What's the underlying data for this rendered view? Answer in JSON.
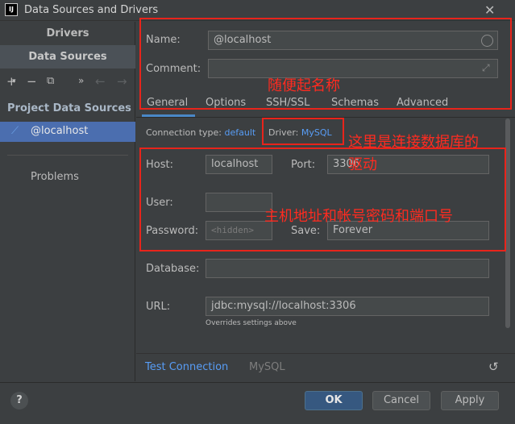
{
  "window": {
    "title": "Data Sources and Drivers",
    "app_icon": "IJ"
  },
  "sidebar": {
    "tabs": [
      {
        "label": "Drivers"
      },
      {
        "label": "Data Sources"
      }
    ],
    "toolbar_icons": [
      "plus-icon",
      "minus-icon",
      "copy-icon",
      "more-icon",
      "back-arrow-icon",
      "forward-arrow-icon"
    ],
    "section_title": "Project Data Sources",
    "items": [
      {
        "label": "@localhost",
        "icon": "mysql-dolphin-icon"
      }
    ],
    "problems_label": "Problems"
  },
  "form": {
    "name_label": "Name:",
    "name_value": "@localhost",
    "comment_label": "Comment:",
    "comment_value": "",
    "tabs": [
      "General",
      "Options",
      "SSH/SSL",
      "Schemas",
      "Advanced"
    ],
    "connection_type_label": "Connection type:",
    "connection_type_value": "default",
    "driver_label": "Driver:",
    "driver_value": "MySQL",
    "host_label": "Host:",
    "host_value": "localhost",
    "port_label": "Port:",
    "port_value": "3306",
    "user_label": "User:",
    "user_value": "",
    "password_label": "Password:",
    "password_value": "<hidden>",
    "save_label": "Save:",
    "save_value": "Forever",
    "database_label": "Database:",
    "database_value": "",
    "url_label": "URL:",
    "url_value": "jdbc:mysql://localhost:3306",
    "url_hint": "Overrides settings above"
  },
  "bottom_tabs": {
    "test_connection": "Test Connection",
    "mysql": "MySQL"
  },
  "buttons": {
    "help": "?",
    "ok": "OK",
    "cancel": "Cancel",
    "apply": "Apply"
  },
  "annotations": {
    "name_note": "随便起名称",
    "driver_note": "这里是连接数据库的",
    "driver_note_line2": "驱动",
    "host_note": "主机地址和帐号密码和端口号",
    "color": "#e8241b"
  },
  "colors": {
    "background": "#3c3f41",
    "accent": "#4a88c7",
    "link": "#589df6",
    "selected_item": "#4b6eaf",
    "ok_button": "#365880"
  }
}
